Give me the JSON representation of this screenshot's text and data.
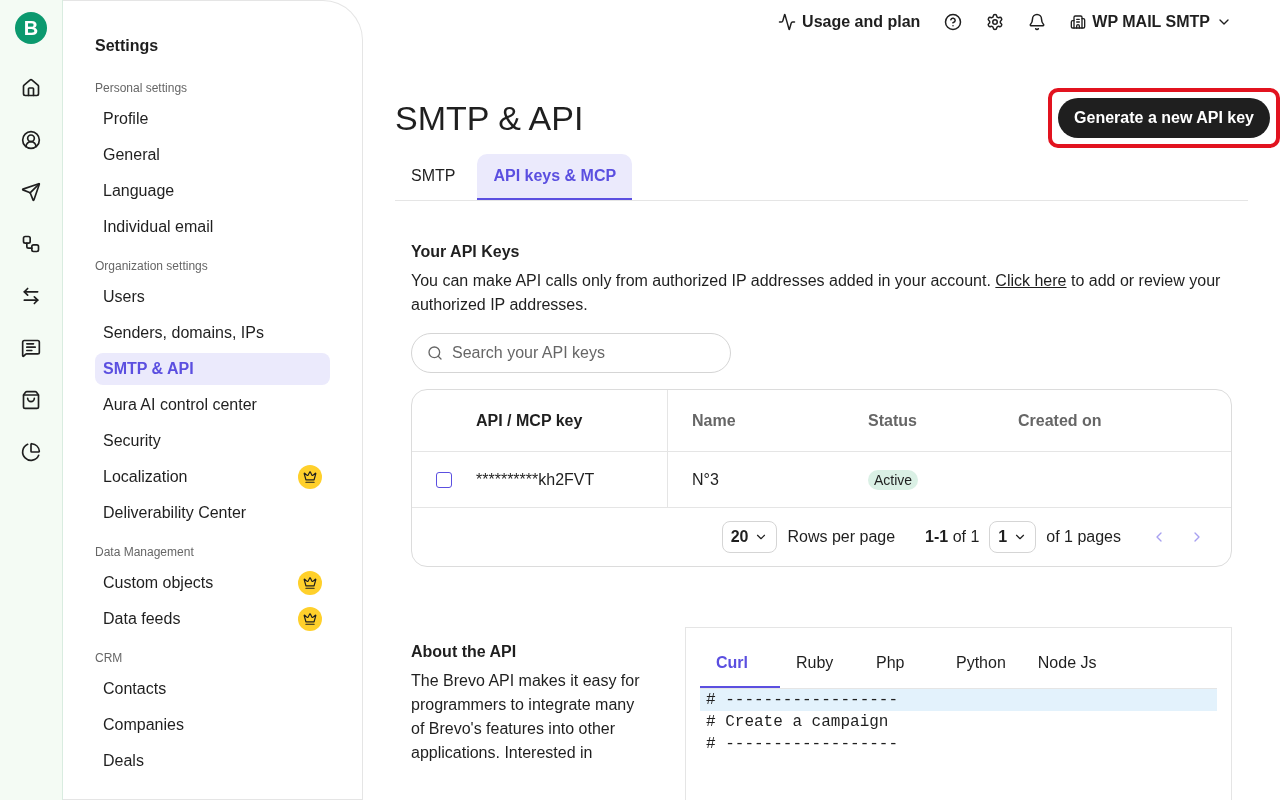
{
  "rail": {
    "logo": "B",
    "items": [
      {
        "selected": false
      },
      {
        "selected": false
      },
      {
        "selected": false
      },
      {
        "selected": false
      },
      {
        "selected": false
      },
      {
        "selected": false
      },
      {
        "selected": false
      },
      {
        "selected": false
      }
    ]
  },
  "settings": {
    "title": "Settings",
    "sections": [
      {
        "title": "Personal settings",
        "items": [
          {
            "label": "Profile",
            "selected": false,
            "premium": false
          },
          {
            "label": "General",
            "selected": false,
            "premium": false
          },
          {
            "label": "Language",
            "selected": false,
            "premium": false
          },
          {
            "label": "Individual email",
            "selected": false,
            "premium": false
          }
        ]
      },
      {
        "title": "Organization settings",
        "items": [
          {
            "label": "Users",
            "selected": false,
            "premium": false
          },
          {
            "label": "Senders, domains, IPs",
            "selected": false,
            "premium": false
          },
          {
            "label": "SMTP & API",
            "selected": true,
            "premium": false
          },
          {
            "label": "Aura AI control center",
            "selected": false,
            "premium": false
          },
          {
            "label": "Security",
            "selected": false,
            "premium": false
          },
          {
            "label": "Localization",
            "selected": false,
            "premium": true
          },
          {
            "label": "Deliverability Center",
            "selected": false,
            "premium": false
          }
        ]
      },
      {
        "title": "Data Management",
        "items": [
          {
            "label": "Custom objects",
            "selected": false,
            "premium": true
          },
          {
            "label": "Data feeds",
            "selected": false,
            "premium": true
          }
        ]
      },
      {
        "title": "CRM",
        "items": [
          {
            "label": "Contacts",
            "selected": false,
            "premium": false
          },
          {
            "label": "Companies",
            "selected": false,
            "premium": false
          },
          {
            "label": "Deals",
            "selected": false,
            "premium": false
          }
        ]
      }
    ]
  },
  "topbar": {
    "usage": "Usage and plan",
    "account": "WP MAIL SMTP"
  },
  "page": {
    "title": "SMTP & API",
    "action": {
      "label": "Generate a new API key",
      "highlighted": true
    },
    "tabs": [
      {
        "label": "SMTP",
        "selected": false
      },
      {
        "label": "API keys & MCP",
        "selected": true
      }
    ],
    "keys": {
      "title": "Your API Keys",
      "text_before": "You can make API calls only from authorized IP addresses added in your account.",
      "link": "Click here",
      "text_after": "to add or review your authorized IP addresses.",
      "search": {
        "placeholder": "Search your API keys"
      },
      "columns": [
        "API / MCP key",
        "Name",
        "Status",
        "Created on"
      ],
      "rows": [
        {
          "checked": false,
          "key": "**********kh2FVT",
          "name": "N°3",
          "status": "Active"
        }
      ],
      "pagination": {
        "rows_per_page": "20",
        "rows_label": "Rows per page",
        "range": "1-1",
        "range_of": "of 1",
        "page": "1",
        "pages": "of 1 pages"
      }
    },
    "about": {
      "title": "About the API",
      "text": "The Brevo API makes it easy for programmers to integrate many of Brevo's features into other applications. Interested in",
      "code_tabs": [
        {
          "label": "Curl",
          "selected": true
        },
        {
          "label": "Ruby",
          "selected": false
        },
        {
          "label": "Php",
          "selected": false
        },
        {
          "label": "Python",
          "selected": false
        },
        {
          "label": "Node Js",
          "selected": false
        }
      ],
      "code_lines": [
        {
          "text": "# ------------------",
          "highlighted": true
        },
        {
          "text": "# Create a campaign",
          "highlighted": false
        },
        {
          "text": "# ------------------",
          "highlighted": false
        }
      ]
    }
  }
}
